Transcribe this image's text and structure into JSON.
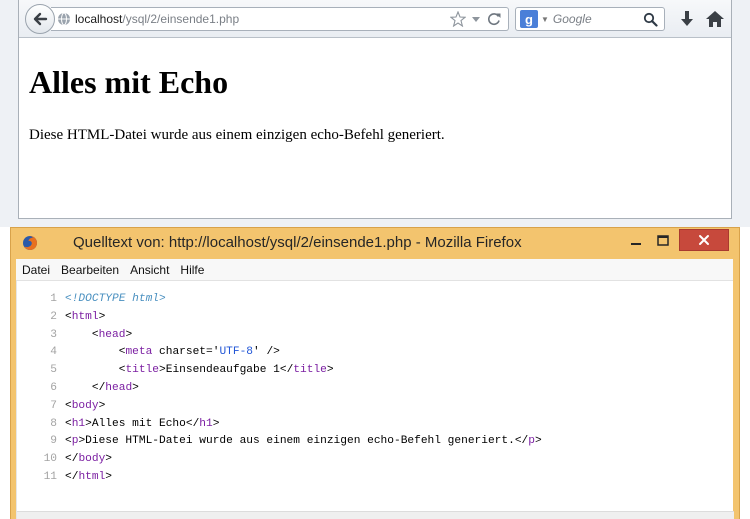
{
  "browser": {
    "url_host": "localhost",
    "url_path": "/ysql/2/einsende1.php",
    "search_placeholder": "Google",
    "page": {
      "heading": "Alles mit Echo",
      "paragraph": "Diese HTML-Datei wurde aus einem einzigen echo-Befehl generiert."
    }
  },
  "source_window": {
    "title": "Quelltext von: http://localhost/ysql/2/einsende1.php - Mozilla Firefox",
    "menu": [
      "Datei",
      "Bearbeiten",
      "Ansicht",
      "Hilfe"
    ],
    "lines": [
      {
        "n": "1",
        "segments": [
          {
            "t": "<!DOCTYPE html>",
            "c": "doctype"
          }
        ]
      },
      {
        "n": "2",
        "segments": [
          {
            "t": "<",
            "c": "plain"
          },
          {
            "t": "html",
            "c": "tag"
          },
          {
            "t": ">",
            "c": "plain"
          }
        ]
      },
      {
        "n": "3",
        "segments": [
          {
            "t": "    <",
            "c": "plain"
          },
          {
            "t": "head",
            "c": "tag"
          },
          {
            "t": ">",
            "c": "plain"
          }
        ]
      },
      {
        "n": "4",
        "segments": [
          {
            "t": "        <",
            "c": "plain"
          },
          {
            "t": "meta",
            "c": "tag"
          },
          {
            "t": " charset='",
            "c": "plain"
          },
          {
            "t": "UTF-8",
            "c": "attr-val"
          },
          {
            "t": "' />",
            "c": "plain"
          }
        ]
      },
      {
        "n": "5",
        "segments": [
          {
            "t": "        <",
            "c": "plain"
          },
          {
            "t": "title",
            "c": "tag"
          },
          {
            "t": ">Einsendeaufgabe 1</",
            "c": "plain"
          },
          {
            "t": "title",
            "c": "tag"
          },
          {
            "t": ">",
            "c": "plain"
          }
        ]
      },
      {
        "n": "6",
        "segments": [
          {
            "t": "    </",
            "c": "plain"
          },
          {
            "t": "head",
            "c": "tag"
          },
          {
            "t": ">",
            "c": "plain"
          }
        ]
      },
      {
        "n": "7",
        "segments": [
          {
            "t": "<",
            "c": "plain"
          },
          {
            "t": "body",
            "c": "tag"
          },
          {
            "t": ">",
            "c": "plain"
          }
        ]
      },
      {
        "n": "8",
        "segments": [
          {
            "t": "<",
            "c": "plain"
          },
          {
            "t": "h1",
            "c": "tag"
          },
          {
            "t": ">Alles mit Echo</",
            "c": "plain"
          },
          {
            "t": "h1",
            "c": "tag"
          },
          {
            "t": ">",
            "c": "plain"
          }
        ]
      },
      {
        "n": "9",
        "segments": [
          {
            "t": "<",
            "c": "plain"
          },
          {
            "t": "p",
            "c": "tag"
          },
          {
            "t": ">Diese HTML-Datei wurde aus einem einzigen echo-Befehl generiert.</",
            "c": "plain"
          },
          {
            "t": "p",
            "c": "tag"
          },
          {
            "t": ">",
            "c": "plain"
          }
        ]
      },
      {
        "n": "10",
        "segments": [
          {
            "t": "</",
            "c": "plain"
          },
          {
            "t": "body",
            "c": "tag"
          },
          {
            "t": ">",
            "c": "plain"
          }
        ]
      },
      {
        "n": "11",
        "segments": [
          {
            "t": "</",
            "c": "plain"
          },
          {
            "t": "html",
            "c": "tag"
          },
          {
            "t": ">",
            "c": "plain"
          }
        ]
      }
    ]
  },
  "colors": {
    "window_frame": "#f3c46e",
    "close_button": "#c7493c",
    "tag": "#7b1fa2",
    "attribute_value": "#1f54d6",
    "doctype": "#4a90c0",
    "line_number": "#a3a3a3"
  },
  "icons": [
    "back-arrow-icon",
    "globe-icon",
    "star-icon",
    "dropdown-icon",
    "reload-icon",
    "google-icon",
    "search-icon",
    "download-icon",
    "home-icon",
    "firefox-icon",
    "minimize-icon",
    "maximize-icon",
    "close-icon"
  ]
}
